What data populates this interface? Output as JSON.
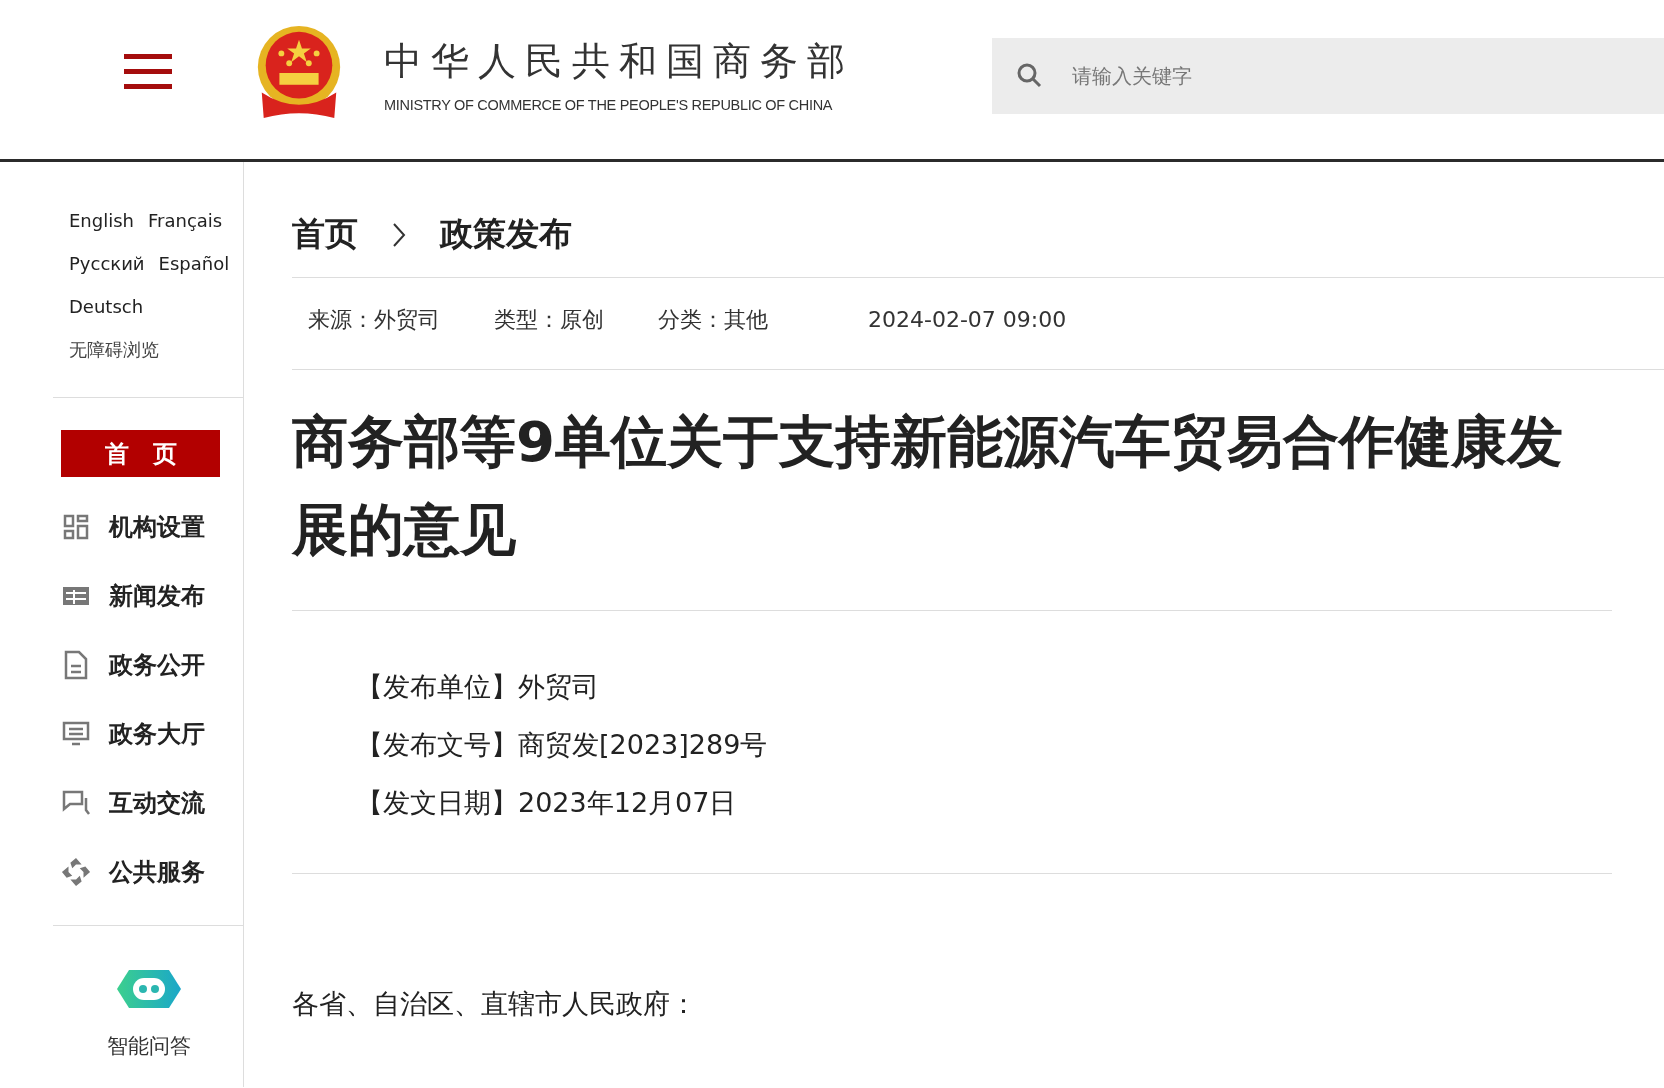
{
  "header": {
    "title": "中华人民共和国商务部",
    "subtitle": "MINISTRY OF COMMERCE OF THE PEOPLE'S REPUBLIC OF CHINA",
    "search": {
      "placeholder": "请输入关键字"
    }
  },
  "sidebar": {
    "languages": [
      [
        "English",
        "Français"
      ],
      [
        "Русский",
        "Español"
      ],
      [
        "Deutsch"
      ]
    ],
    "accessibility": "无障碍浏览",
    "nav": [
      {
        "label": "首　页",
        "kind": "home",
        "selected": true
      },
      {
        "label": "机构设置",
        "kind": "grid",
        "selected": false
      },
      {
        "label": "新闻发布",
        "kind": "news",
        "selected": false
      },
      {
        "label": "政务公开",
        "kind": "doc",
        "selected": false
      },
      {
        "label": "政务大厅",
        "kind": "screen",
        "selected": false
      },
      {
        "label": "互动交流",
        "kind": "chat",
        "selected": false
      },
      {
        "label": "公共服务",
        "kind": "service",
        "selected": false
      }
    ],
    "assistant": "智能问答"
  },
  "breadcrumb": [
    "首页",
    "政策发布"
  ],
  "meta": [
    {
      "label": "来源：",
      "value": "外贸司"
    },
    {
      "label": "类型：",
      "value": "原创"
    },
    {
      "label": "分类：",
      "value": "其他"
    }
  ],
  "date": "2024-02-07 09:00",
  "article": {
    "title": "商务部等9单位关于支持新能源汽车贸易合作健康发展的意见",
    "info": [
      "【发布单位】外贸司",
      "【发布文号】商贸发[2023]289号",
      "【发文日期】2023年12月07日"
    ],
    "greeting": "各省、自治区、直辖市人民政府："
  }
}
